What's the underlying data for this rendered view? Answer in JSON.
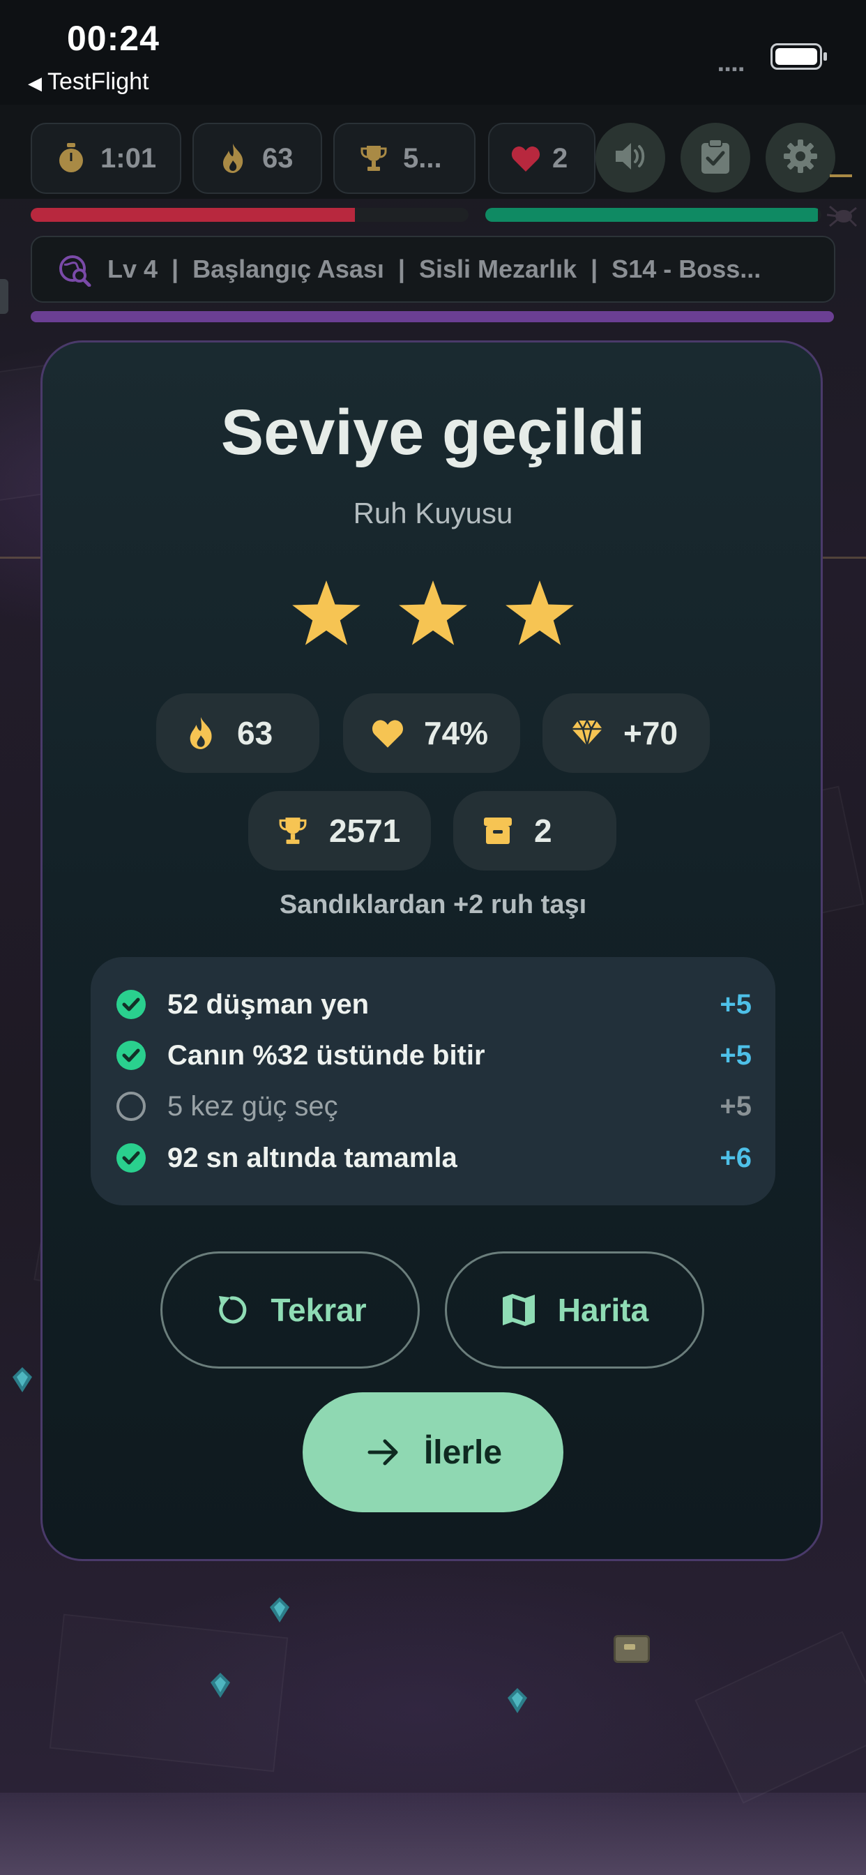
{
  "status_bar": {
    "time": "00:24",
    "back_label": "TestFlight"
  },
  "hud": {
    "timer": "1:01",
    "kills": "63",
    "trophies": "5...",
    "lives": "2",
    "hp_fraction": 0.74,
    "energy_fraction": 0.99,
    "level_info": "Lv 4  |  Başlangıç Asası  |  Sisli Mezarlık  |  S14 - Boss...",
    "icons": [
      "stopwatch-icon",
      "flame-icon",
      "trophy-icon",
      "heart-icon",
      "speaker-icon",
      "clipboard-check-icon",
      "gear-icon"
    ]
  },
  "result": {
    "title": "Seviye geçildi",
    "subtitle": "Ruh Kuyusu",
    "stars_earned": 3,
    "stars_total": 3,
    "stats": [
      {
        "icon": "flame-icon",
        "value": "63"
      },
      {
        "icon": "heart-icon",
        "value": "74%"
      },
      {
        "icon": "gem-icon",
        "value": "+70"
      },
      {
        "icon": "trophy-icon",
        "value": "2571"
      },
      {
        "icon": "chest-icon",
        "value": "2"
      }
    ],
    "chest_note": "Sandıklardan +2 ruh taşı",
    "objectives": [
      {
        "text": "52 düşman yen",
        "reward": "+5",
        "done": true
      },
      {
        "text": "Canın %32 üstünde bitir",
        "reward": "+5",
        "done": true
      },
      {
        "text": "5 kez güç seç",
        "reward": "+5",
        "done": false
      },
      {
        "text": "92 sn altında tamamla",
        "reward": "+6",
        "done": true
      }
    ],
    "buttons": {
      "retry": "Tekrar",
      "map": "Harita",
      "continue": "İlerle"
    }
  },
  "colors": {
    "accent_green": "#8fd8b2",
    "reward_blue": "#4ec0e8",
    "star_gold": "#f6c453",
    "hp_red": "#b8283e",
    "xp_purple": "#6b3f93"
  }
}
